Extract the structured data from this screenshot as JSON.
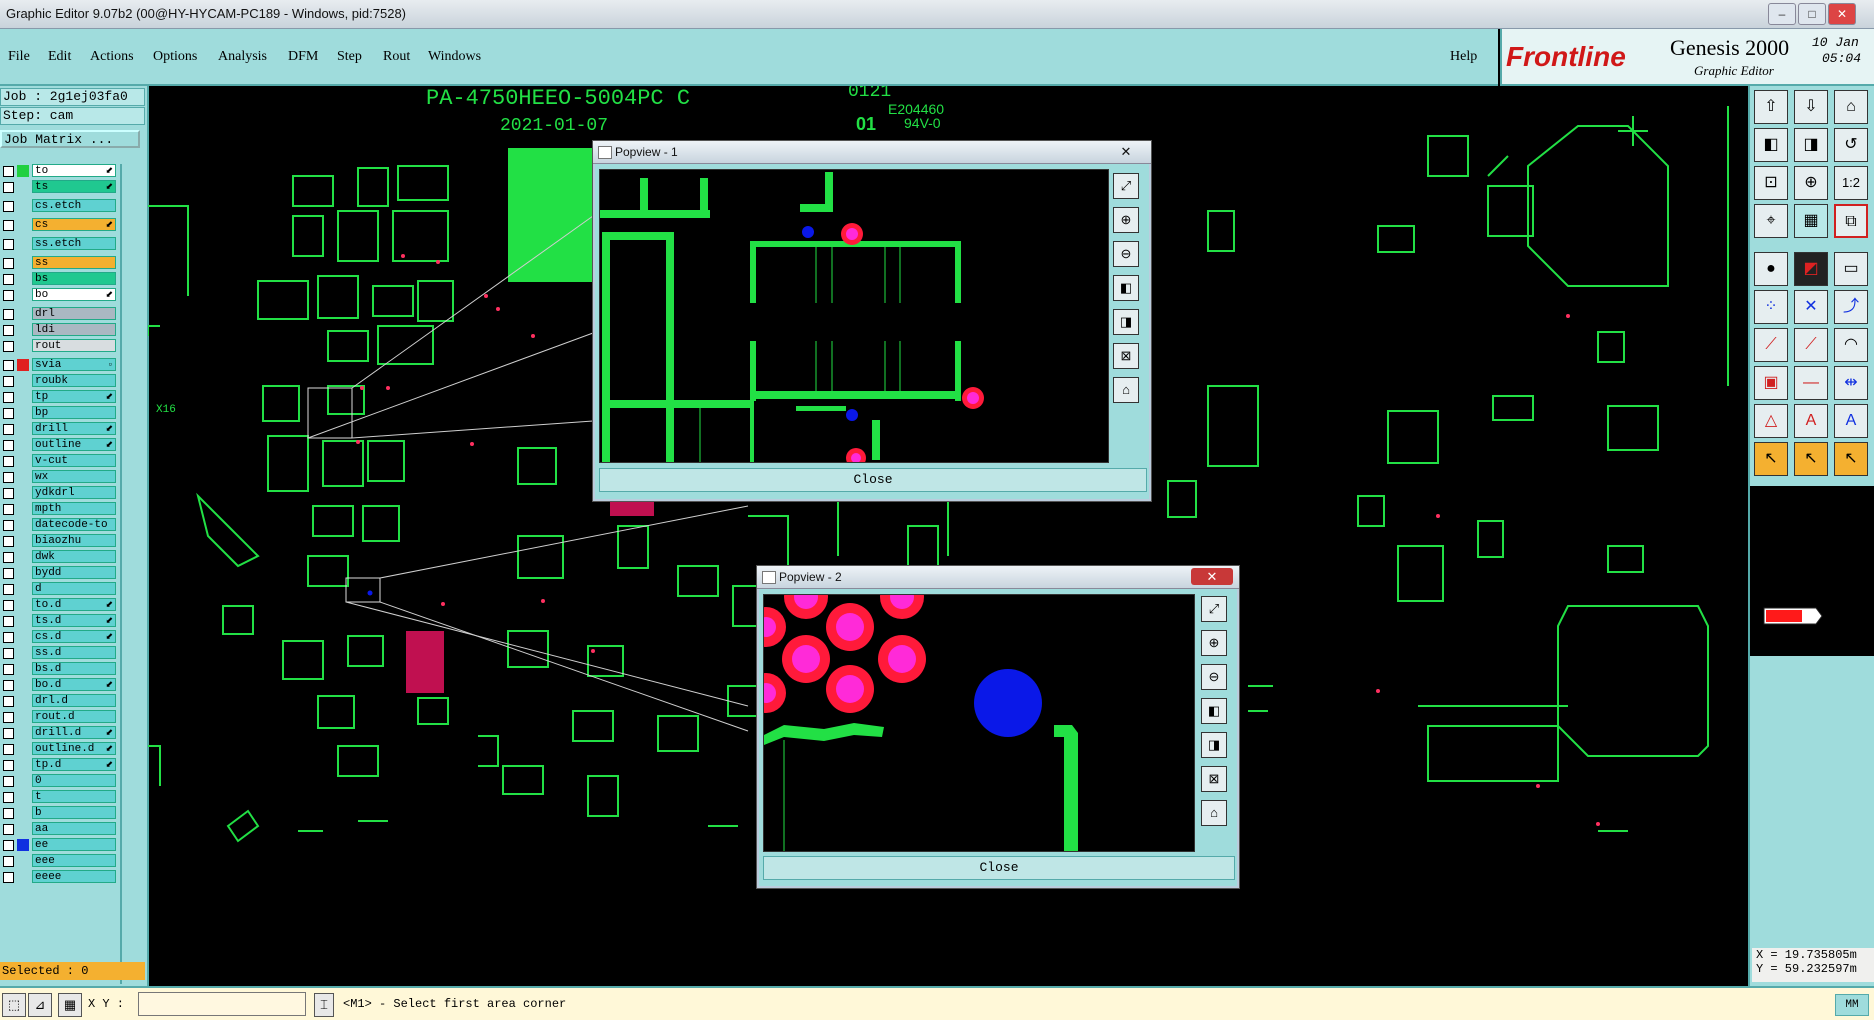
{
  "window": {
    "title": "Graphic Editor 9.07b2 (00@HY-HYCAM-PC189 - Windows, pid:7528)",
    "buttons": [
      "–",
      "□",
      "✕"
    ]
  },
  "menu": [
    "File",
    "Edit",
    "Actions",
    "Options",
    "Analysis",
    "DFM",
    "Step",
    "Rout",
    "Windows"
  ],
  "help_label": "Help",
  "brand": {
    "logo": "Frontline",
    "product": "Genesis 2000",
    "subtitle": "Graphic Editor",
    "date": "10 Jan",
    "time": "05:04"
  },
  "job": {
    "job_label": "Job : 2g1ej03fa0",
    "step_label": "Step: cam",
    "matrix_button": "Job Matrix ..."
  },
  "layers": [
    {
      "name": "to",
      "color": "#20d040",
      "style": "sel",
      "arrow": "⬋"
    },
    {
      "name": "ts",
      "color": "",
      "style": "sig",
      "arrow": "⬋"
    },
    {
      "name": "cs.etch",
      "color": "",
      "style": "",
      "arrow": ""
    },
    {
      "name": "cs",
      "color": "",
      "style": "sigo",
      "arrow": "⬋"
    },
    {
      "name": "ss.etch",
      "color": "",
      "style": "",
      "arrow": ""
    },
    {
      "name": "ss",
      "color": "",
      "style": "sigo",
      "arrow": ""
    },
    {
      "name": "bs",
      "color": "",
      "style": "sig",
      "arrow": ""
    },
    {
      "name": "bo",
      "color": "",
      "style": "sel",
      "arrow": "⬋"
    },
    {
      "name": "drl",
      "color": "",
      "style": "gray",
      "arrow": ""
    },
    {
      "name": "ldi",
      "color": "",
      "style": "gray",
      "arrow": ""
    },
    {
      "name": "rout",
      "color": "",
      "style": "lgray",
      "arrow": ""
    },
    {
      "name": "svia",
      "color": "#e02020",
      "style": "",
      "arrow": "▫"
    },
    {
      "name": "roubk",
      "color": "",
      "style": "",
      "arrow": ""
    },
    {
      "name": "tp",
      "color": "",
      "style": "",
      "arrow": "⬋"
    },
    {
      "name": "bp",
      "color": "",
      "style": "",
      "arrow": ""
    },
    {
      "name": "drill",
      "color": "",
      "style": "",
      "arrow": "⬋"
    },
    {
      "name": "outline",
      "color": "",
      "style": "",
      "arrow": "⬋"
    },
    {
      "name": "v-cut",
      "color": "",
      "style": "",
      "arrow": ""
    },
    {
      "name": "wx",
      "color": "",
      "style": "",
      "arrow": ""
    },
    {
      "name": "ydkdrl",
      "color": "",
      "style": "",
      "arrow": ""
    },
    {
      "name": "mpth",
      "color": "",
      "style": "",
      "arrow": ""
    },
    {
      "name": "datecode-to",
      "color": "",
      "style": "",
      "arrow": ""
    },
    {
      "name": "biaozhu",
      "color": "",
      "style": "",
      "arrow": ""
    },
    {
      "name": "dwk",
      "color": "",
      "style": "",
      "arrow": ""
    },
    {
      "name": "bydd",
      "color": "",
      "style": "",
      "arrow": ""
    },
    {
      "name": "d",
      "color": "",
      "style": "",
      "arrow": ""
    },
    {
      "name": "to.d",
      "color": "",
      "style": "",
      "arrow": "⬋"
    },
    {
      "name": "ts.d",
      "color": "",
      "style": "",
      "arrow": "⬋"
    },
    {
      "name": "cs.d",
      "color": "",
      "style": "",
      "arrow": "⬋"
    },
    {
      "name": "ss.d",
      "color": "",
      "style": "",
      "arrow": ""
    },
    {
      "name": "bs.d",
      "color": "",
      "style": "",
      "arrow": ""
    },
    {
      "name": "bo.d",
      "color": "",
      "style": "",
      "arrow": "⬋"
    },
    {
      "name": "drl.d",
      "color": "",
      "style": "",
      "arrow": ""
    },
    {
      "name": "rout.d",
      "color": "",
      "style": "",
      "arrow": ""
    },
    {
      "name": "drill.d",
      "color": "",
      "style": "",
      "arrow": "⬋"
    },
    {
      "name": "outline.d",
      "color": "",
      "style": "",
      "arrow": "⬋"
    },
    {
      "name": "tp.d",
      "color": "",
      "style": "",
      "arrow": "⬋"
    },
    {
      "name": "0",
      "color": "",
      "style": "",
      "arrow": ""
    },
    {
      "name": "t",
      "color": "",
      "style": "",
      "arrow": ""
    },
    {
      "name": "b",
      "color": "",
      "style": "",
      "arrow": ""
    },
    {
      "name": "aa",
      "color": "",
      "style": "",
      "arrow": ""
    },
    {
      "name": "ee",
      "color": "#1030e0",
      "style": "",
      "arrow": ""
    },
    {
      "name": "eee",
      "color": "",
      "style": "",
      "arrow": ""
    },
    {
      "name": "eeee",
      "color": "",
      "style": "",
      "arrow": ""
    }
  ],
  "selected_label": "Selected : 0",
  "status": {
    "xy_label": "X Y :",
    "prompt": "<M1> - Select first area corner",
    "units": "MM"
  },
  "coords": {
    "x": "X = 19.735805m",
    "y": "Y = 59.232597m"
  },
  "board_text": {
    "part_number": "PA-4750HEEO-5004PC C",
    "date_partial": "2021-01-07",
    "code1": "0121",
    "cert": "E204460",
    "rating": "94V-0",
    "ul": "01",
    "ref1": "X16"
  },
  "popups": [
    {
      "title": "Popview - 1",
      "close_label": "Close"
    },
    {
      "title": "Popview - 2",
      "close_label": "Close"
    }
  ],
  "popup_buttons": [
    "fit-icon",
    "zoom-in-icon",
    "zoom-out-icon",
    "pan-left-icon",
    "pan-right-icon",
    "zoom-area-icon",
    "home-icon"
  ],
  "colors": {
    "background": "#000000",
    "trace": "#22e045",
    "pad_red": "#ff1a3a",
    "pad_magenta": "#ff2ad8",
    "via_blue": "#0a18e8",
    "panel": "#9fdcdc"
  }
}
